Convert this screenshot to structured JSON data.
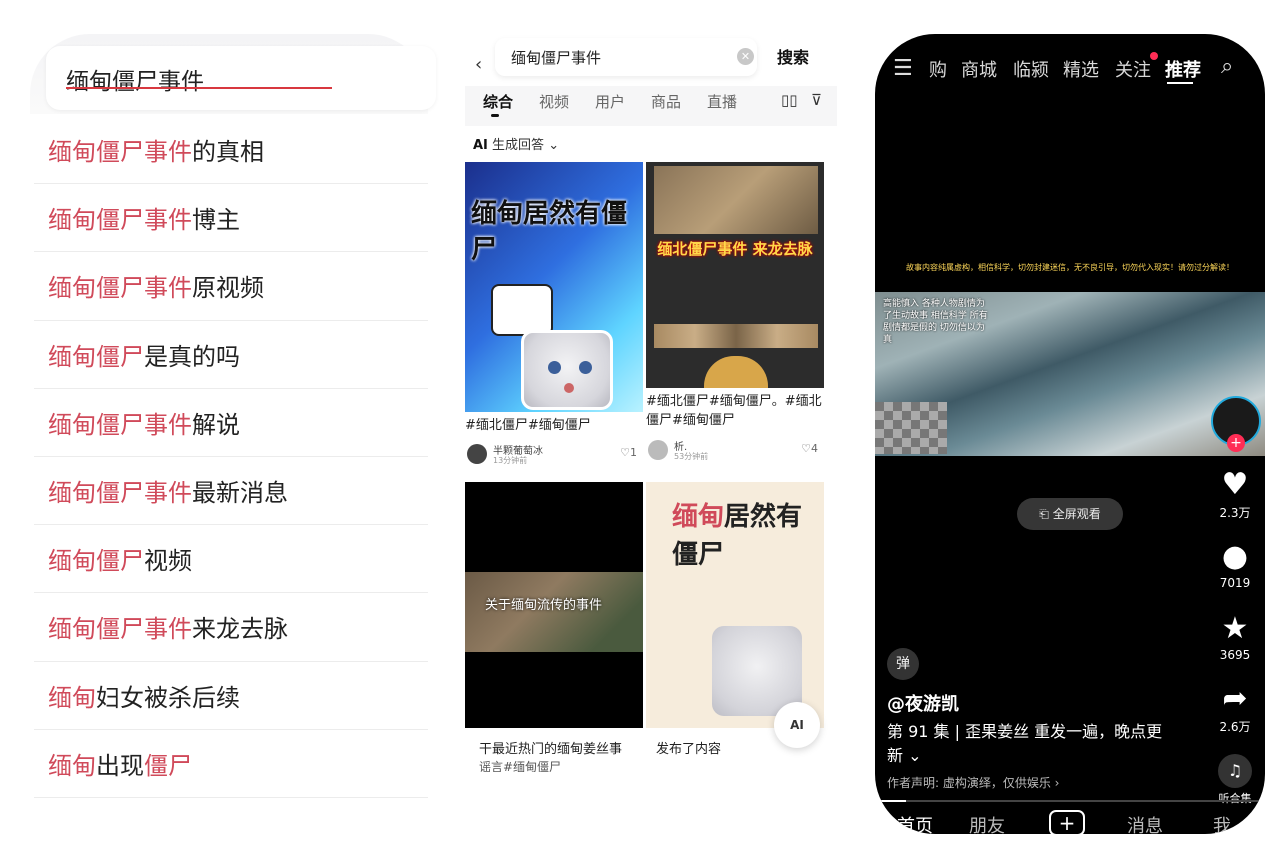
{
  "panel1": {
    "search_value": "缅甸僵尸事件",
    "suggestions": [
      {
        "hl": "缅甸僵尸事件",
        "rest": "的真相"
      },
      {
        "hl": "缅甸僵尸事件",
        "rest": "博主"
      },
      {
        "hl": "缅甸僵尸事件",
        "rest": "原视频"
      },
      {
        "hl": "缅甸僵尸",
        "rest": "是真的吗"
      },
      {
        "hl": "缅甸僵尸事件",
        "rest": "解说"
      },
      {
        "hl": "缅甸僵尸事件",
        "rest": "最新消息"
      },
      {
        "hl": "缅甸僵尸",
        "rest": "视频"
      },
      {
        "hl": "缅甸僵尸事件",
        "rest": "来龙去脉"
      },
      {
        "hl": "缅甸",
        "rest": "妇女被杀后续"
      },
      {
        "hl": "缅甸",
        "rest": "出现",
        "hl2": "僵尸"
      }
    ]
  },
  "panel2": {
    "search_value": "缅甸僵尸事件",
    "search_button": "搜索",
    "tabs": [
      "综合",
      "视频",
      "用户",
      "商品",
      "直播"
    ],
    "ai_label": "AI",
    "ai_text": "生成回答",
    "cards": [
      {
        "overlay": "缅甸居然有僵尸",
        "caption": "#缅北僵尸#缅甸僵尸",
        "author": "半颗葡萄冰",
        "ago": "13分钟前",
        "likes": "1"
      },
      {
        "overlay": "缅北僵尸事件 来龙去脉",
        "caption": "#缅北僵尸#缅甸僵尸。#缅北僵尸#缅甸僵尸",
        "author": "析.",
        "ago": "53分钟前",
        "likes": "4"
      },
      {
        "overlay": "关于缅甸流传的事件",
        "caption": "干最近热门的缅甸姜丝事",
        "caption2": "谣言#缅甸僵尸"
      },
      {
        "overlay_hl": "缅甸",
        "overlay_rest": "居然有",
        "overlay_line2": "僵尸",
        "caption": "发布了内容"
      }
    ],
    "fab": "AI"
  },
  "panel3": {
    "nav": [
      "购",
      "商城",
      "临颍",
      "精选",
      "关注",
      "推荐"
    ],
    "disclaimer": "故事内容纯属虚构，相信科学，切勿封建迷信，无不良引导，切勿代入现实！请勿过分解读！",
    "video_overlay": "高能慎入 各种人物剧情为了生动故事 相信科学 所有剧情都是假的 切勿信以为真",
    "fullscreen": "全屏观看",
    "likes": "2.3万",
    "comments": "7019",
    "favorites": "3695",
    "shares": "2.6万",
    "danmu": "弹",
    "author": "@夜游凯",
    "description": "第 91 集 | 歪果姜丝 重发一遍，晚点更新",
    "declaration": "作者声明: 虚构演绎，仅供娱乐 ›",
    "listen": "听合集",
    "tabs": [
      "首页",
      "朋友",
      "消息",
      "我"
    ],
    "progress": 0.08
  }
}
